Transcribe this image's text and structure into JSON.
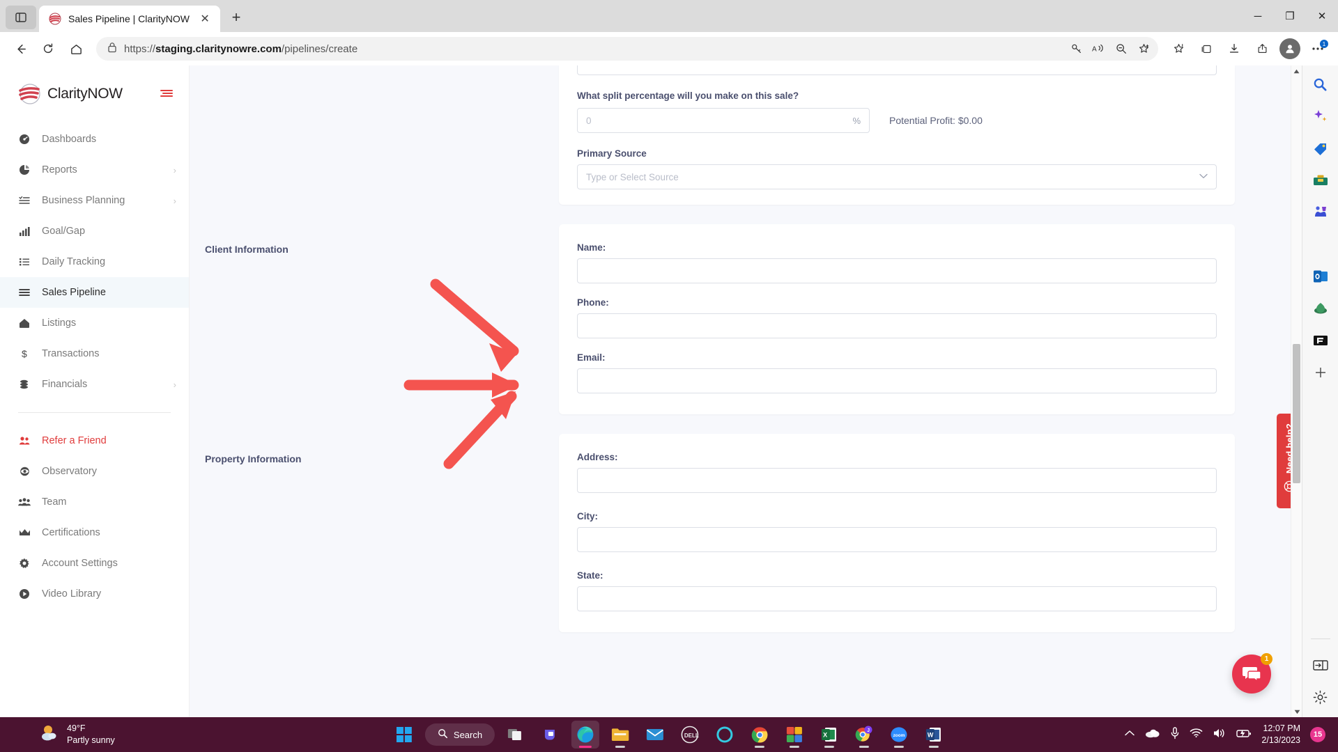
{
  "browser": {
    "tab": {
      "title": "Sales Pipeline | ClarityNOW",
      "close_label": "✕",
      "favicon_name": "claritynow-favicon"
    },
    "newtab_label": "+",
    "window_controls": {
      "minimize": "─",
      "maximize": "❐",
      "close": "✕"
    },
    "url_prefix": "https://",
    "url_bold": "staging.claritynowre.com",
    "url_suffix": "/pipelines/create",
    "tab_list_icon": "tab-list-icon"
  },
  "sidebar": {
    "brand": "ClarityNOW",
    "collapse_label": "≡",
    "items": [
      {
        "label": "Dashboards",
        "icon": "dashboard-icon",
        "caret": "",
        "state": "normal"
      },
      {
        "label": "Reports",
        "icon": "pie-chart-icon",
        "caret": "›",
        "state": "normal"
      },
      {
        "label": "Business Planning",
        "icon": "task-list-icon",
        "caret": "›",
        "state": "normal"
      },
      {
        "label": "Goal/Gap",
        "icon": "bar-chart-icon",
        "caret": "",
        "state": "normal"
      },
      {
        "label": "Daily Tracking",
        "icon": "list-icon",
        "caret": "",
        "state": "normal"
      },
      {
        "label": "Sales Pipeline",
        "icon": "pipeline-icon",
        "caret": "",
        "state": "active"
      },
      {
        "label": "Listings",
        "icon": "home-icon",
        "caret": "",
        "state": "normal"
      },
      {
        "label": "Transactions",
        "icon": "dollar-icon",
        "caret": "",
        "state": "normal"
      },
      {
        "label": "Financials",
        "icon": "coins-icon",
        "caret": "›",
        "state": "normal"
      }
    ],
    "items_lower": [
      {
        "label": "Refer a Friend",
        "icon": "users-icon",
        "caret": "",
        "state": "accent"
      },
      {
        "label": "Observatory",
        "icon": "eye-icon",
        "caret": "",
        "state": "normal"
      },
      {
        "label": "Team",
        "icon": "team-icon",
        "caret": "",
        "state": "normal"
      },
      {
        "label": "Certifications",
        "icon": "crown-icon",
        "caret": "",
        "state": "normal"
      },
      {
        "label": "Account Settings",
        "icon": "gear-icon",
        "caret": "",
        "state": "normal"
      },
      {
        "label": "Video Library",
        "icon": "play-circle-icon",
        "caret": "",
        "state": "normal"
      }
    ]
  },
  "form": {
    "split_question": "What split percentage will you make on this sale?",
    "split_value": "0",
    "split_suffix": "%",
    "potential_profit_label": "Potential Profit:",
    "potential_profit_value": "$0.00",
    "primary_source_label": "Primary Source",
    "primary_source_placeholder": "Type or Select Source",
    "sections": [
      {
        "title": "Client Information",
        "fields": [
          {
            "label": "Name:",
            "value": ""
          },
          {
            "label": "Phone:",
            "value": ""
          },
          {
            "label": "Email:",
            "value": ""
          }
        ]
      },
      {
        "title": "Property Information",
        "fields": [
          {
            "label": "Address:",
            "value": ""
          },
          {
            "label": "City:",
            "value": ""
          },
          {
            "label": "State:",
            "value": ""
          }
        ]
      }
    ]
  },
  "widgets": {
    "need_help": "Need help?",
    "chat_badge": "1"
  },
  "edge_rail": {
    "icons": [
      "search-icon",
      "copilot-sparkle-icon",
      "shopping-tag-icon",
      "tool-kit-icon",
      "games-icon",
      "microsoft-365-icon",
      "outlook-icon",
      "drop-icon",
      "f-logo-icon",
      "add-icon"
    ],
    "bottom_icons": [
      "split-screen-icon",
      "settings-gear-icon"
    ]
  },
  "taskbar": {
    "weather_temp": "49°F",
    "weather_desc": "Partly sunny",
    "search_label": "Search",
    "apps": [
      "start-icon",
      "task-view-icon",
      "teams-icon",
      "edge-icon",
      "file-explorer-icon",
      "mail-icon",
      "dell-icon",
      "circle-app-icon",
      "chrome-icon",
      "photos-app-icon",
      "excel-icon",
      "chrome-profile-icon",
      "zoom-icon",
      "word-icon"
    ],
    "tray": [
      "chevron-up-icon",
      "onedrive-icon",
      "microphone-icon",
      "wifi-icon",
      "volume-icon",
      "battery-icon"
    ],
    "time": "12:07 PM",
    "date": "2/13/2023",
    "notification_count": "15"
  },
  "colors": {
    "accent_red": "#e03c3c",
    "taskbar": "#4b1330",
    "label_blue": "#4a4f6e",
    "page_bg": "#f7f8fc",
    "arrow_red": "#f4544f"
  }
}
